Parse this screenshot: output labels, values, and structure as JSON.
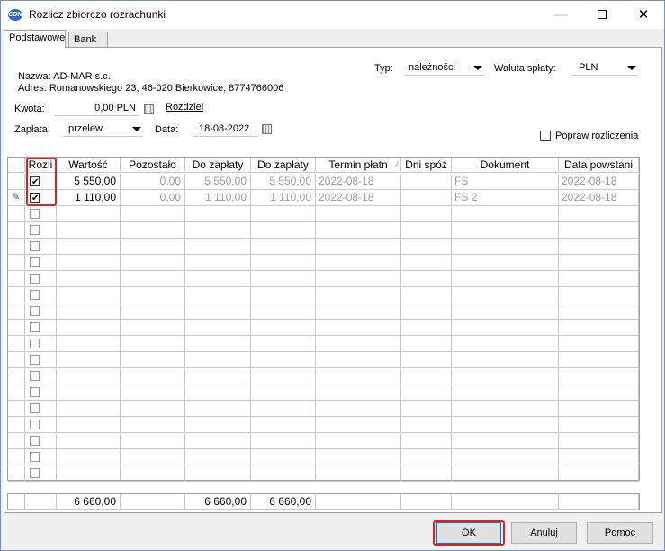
{
  "window": {
    "title": "Rozlicz zbiorczo rozrachunki",
    "app_icon_text": "CDN",
    "minimize_glyph": "—",
    "close_glyph": "✕"
  },
  "tabs": [
    {
      "label": "Podstawowe",
      "active": true
    },
    {
      "label": "Bank",
      "active": false
    }
  ],
  "header": {
    "name_line": "Nazwa: AD-MAR s.c.",
    "address_line": "Adres: Romanowskiego 23, 46-020 Bierkowice, 8774766006",
    "typ_label": "Typ:",
    "typ_value": "należności",
    "currency_label": "Waluta spłaty:",
    "currency_value": "PLN",
    "kwota_label": "Kwota:",
    "kwota_value": "0,00 PLN",
    "rozdziel_link": "Rozdziel",
    "zaplata_label": "Zapłata:",
    "zaplata_value": "przelew",
    "data_label": "Data:",
    "data_value": "18-08-2022",
    "popraw_label": "Popraw rozliczenia",
    "popraw_checked": false
  },
  "grid": {
    "columns": [
      "Rozli",
      "Wartość",
      "Pozostało",
      "Do zapłaty",
      "Do zapłaty",
      "Termin płatn",
      "Dni spóź",
      "Dokument",
      "Data powstani"
    ],
    "sort_glyph": "∕",
    "rows": [
      {
        "checked": true,
        "wartosc": "5 550,00",
        "pozostalo": "0,00",
        "do_zaplaty_1": "5 550,00",
        "do_zaplaty_2": "5 550,00",
        "termin": "2022-08-18",
        "dni": "",
        "dokument": "FS",
        "data_powstania": "2022-08-18"
      },
      {
        "checked": true,
        "wartosc": "1 110,00",
        "pozostalo": "0,00",
        "do_zaplaty_1": "1 110,00",
        "do_zaplaty_2": "1 110,00",
        "termin": "2022-08-18",
        "dni": "",
        "dokument": "FS 2",
        "data_powstania": "2022-08-18"
      }
    ],
    "empty_rows": 17,
    "edit_marker": "✎",
    "totals": {
      "wartosc": "6 660,00",
      "do_zaplaty_1": "6 660,00",
      "do_zaplaty_2": "6 660,00"
    }
  },
  "buttons": {
    "ok": "OK",
    "cancel": "Anuluj",
    "help": "Pomoc"
  },
  "colors": {
    "highlight": "#e02020",
    "dim_text": "#a0a0a0"
  }
}
